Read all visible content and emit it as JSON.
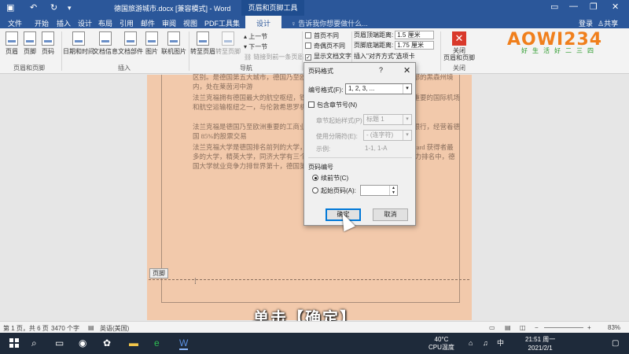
{
  "titlebar": {
    "title": "德国旅游城市.docx [兼容模式] - Word",
    "context_tools": "页眉和页脚工具",
    "minimize": "—",
    "restore": "❐",
    "close": "✕"
  },
  "tabs": {
    "items": [
      "文件",
      "开始",
      "插入",
      "设计",
      "布局",
      "引用",
      "邮件",
      "审阅",
      "视图",
      "PDF工具集"
    ],
    "active": "设计",
    "tell_me": "告诉我你想要做什么...",
    "login": "登录",
    "share": "共享"
  },
  "ribbon": {
    "header_footer_group": {
      "buttons": [
        "页眉",
        "页脚",
        "页码"
      ],
      "label": "页眉和页脚"
    },
    "insert_group": {
      "buttons": [
        "日期和时间",
        "文档信息",
        "文档部件",
        "图片",
        "联机图片"
      ],
      "label": "插入"
    },
    "nav_group": {
      "goto_header": "转至页眉",
      "goto_footer": "转至页脚",
      "prev": "上一节",
      "next": "下一节",
      "link_previous": "链接到前一条页眉",
      "label": "导航"
    },
    "options": {
      "first_page": "首页不同",
      "odd_even": "奇偶页不同",
      "show_text": "显示文档文字"
    },
    "position": {
      "header_label": "页眉顶端距离:",
      "header_value": "1.5 厘米",
      "footer_label": "页脚底端距离:",
      "footer_value": "1.75 厘米",
      "align_tab": "插入\"对齐方式\"选项卡"
    },
    "close_group": {
      "button": "关闭\n页眉和页脚",
      "label": "关闭"
    }
  },
  "logo": {
    "main": "AOWI234",
    "sub": "好生活好二三四"
  },
  "document": {
    "paragraphs": [
      "区别。是德国第五大城市，德国乃至欧洲最重要的交通枢纽。它位于德国西部的黑森州境内，处在莱茵河中游",
      "法兰克福拥有德国最大的航空枢纽，铁路枢纽。法兰克福机场已成为全球最重要的国际机场和航空运输枢纽之一，与伦敦希思罗机场和巴黎戴高乐机场并列为欧洲第",
      "法兰克福是德国乃至欧洲重要的工商业、金融和交通中心，拥有超过 324 家银行，经营着德国 85%的股票交易",
      "法兰克福大学是德国排名前列的大学，拥有 18 位诺贝尔奖得主和 Leibniz-Award 获得者最多的大学，精英大学，同济大学有三个合作单位。2012 年全球毕业生就业能力排名中，德国大学就业竞争力排世界第十，德国第一。"
    ],
    "footer_tag": "页脚"
  },
  "dialog": {
    "title": "页码格式",
    "help": "?",
    "close": "✕",
    "number_format_label": "编号格式(F):",
    "number_format_value": "1, 2, 3, ...",
    "include_chapter": "包含章节号(N)",
    "chapter_style_label": "章节起始样式(P)",
    "chapter_style_value": "标题 1",
    "separator_label": "使用分隔符(E):",
    "separator_value": "-  (连字符)",
    "example_label": "示例:",
    "example_value": "1-1, 1-A",
    "numbering_label": "页码编号",
    "continue_label": "续前节(C)",
    "start_at_label": "起始页码(A):",
    "ok": "确定",
    "cancel": "取消"
  },
  "caption": "单击【确定】",
  "statusbar": {
    "page": "第 1 页，共 6 页",
    "words": "3470 个字",
    "lang": "英语(美国)",
    "zoom": "83%"
  },
  "taskbar": {
    "temp": "40°C",
    "cpu": "CPU温度",
    "time": "21:51 周一",
    "date": "2021/2/1",
    "ime": "中"
  }
}
